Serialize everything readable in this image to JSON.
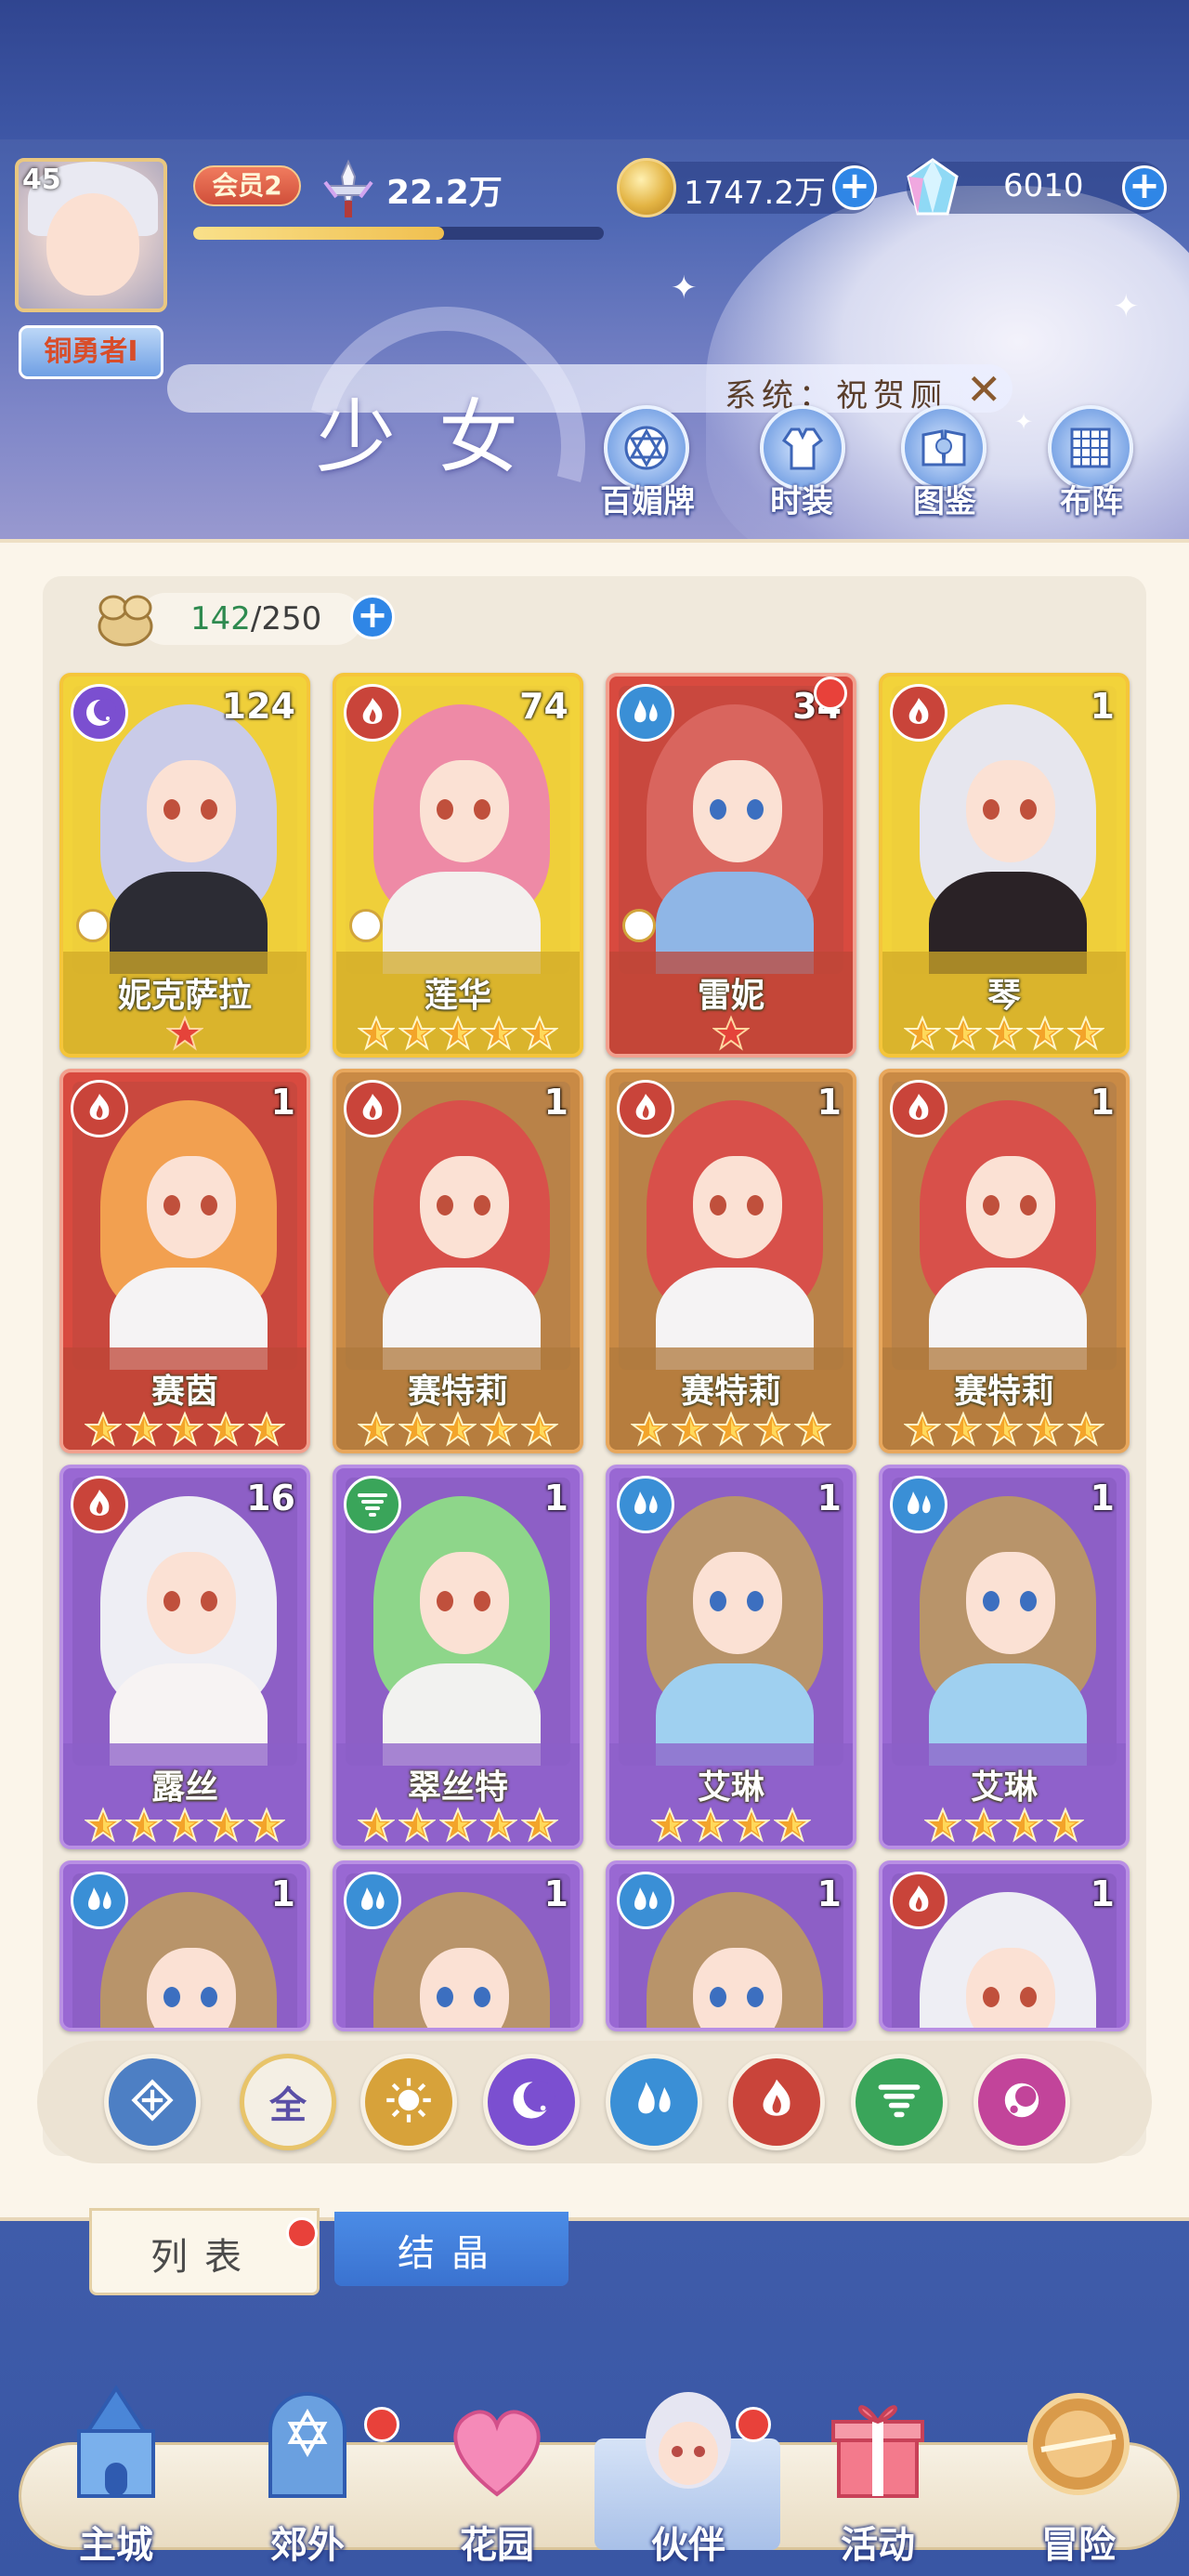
{
  "player": {
    "level": "45",
    "rank": "铜勇者Ⅰ",
    "vip": "会员2",
    "power": "22.2万",
    "exp_fraction": 0.61
  },
  "currency": {
    "gold": "1747.2万",
    "gems": "6010"
  },
  "notice": {
    "text": "系统：祝贺厕"
  },
  "header": {
    "title": "少女"
  },
  "menu": {
    "items": [
      {
        "label": "百媚牌",
        "icon": "card-icon"
      },
      {
        "label": "时装",
        "icon": "outfit-icon"
      },
      {
        "label": "图鉴",
        "icon": "book-icon"
      },
      {
        "label": "布阵",
        "icon": "formation-icon"
      }
    ]
  },
  "capacity": {
    "current": "142",
    "max": "/250"
  },
  "cards": [
    {
      "name": "妮克萨拉",
      "count": "124",
      "stars": 1,
      "element": "moon",
      "frame": "gold"
    },
    {
      "name": "莲华",
      "count": "74",
      "stars": 5,
      "element": "fire",
      "frame": "gold"
    },
    {
      "name": "雷妮",
      "count": "34",
      "stars": 1,
      "element": "water",
      "frame": "red"
    },
    {
      "name": "琴",
      "count": "1",
      "stars": 5,
      "element": "fire",
      "frame": "gold"
    },
    {
      "name": "赛茵",
      "count": "1",
      "stars": 5,
      "element": "fire",
      "frame": "red"
    },
    {
      "name": "赛特莉",
      "count": "1",
      "stars": 5,
      "element": "fire",
      "frame": "orange"
    },
    {
      "name": "赛特莉",
      "count": "1",
      "stars": 5,
      "element": "fire",
      "frame": "orange"
    },
    {
      "name": "赛特莉",
      "count": "1",
      "stars": 5,
      "element": "fire",
      "frame": "orange"
    },
    {
      "name": "露丝",
      "count": "16",
      "stars": 5,
      "element": "fire",
      "frame": "purple"
    },
    {
      "name": "翠丝特",
      "count": "1",
      "stars": 5,
      "element": "wind",
      "frame": "purple"
    },
    {
      "name": "艾琳",
      "count": "1",
      "stars": 4,
      "element": "water",
      "frame": "purple"
    },
    {
      "name": "艾琳",
      "count": "1",
      "stars": 4,
      "element": "water",
      "frame": "purple"
    },
    {
      "name": "",
      "count": "1",
      "stars": 0,
      "element": "water",
      "frame": "purple"
    },
    {
      "name": "",
      "count": "1",
      "stars": 0,
      "element": "water",
      "frame": "purple"
    },
    {
      "name": "",
      "count": "1",
      "stars": 0,
      "element": "water",
      "frame": "purple"
    },
    {
      "name": "",
      "count": "1",
      "stars": 0,
      "element": "fire",
      "frame": "purple"
    }
  ],
  "filters": {
    "all_label": "全",
    "items": [
      "class-icon",
      "all",
      "sun-icon",
      "moon-icon",
      "water-icon",
      "fire-icon",
      "wind-icon",
      "dark-icon"
    ]
  },
  "tabs": {
    "list": "列表",
    "crystal": "结晶"
  },
  "nav": {
    "items": [
      {
        "label": "主城",
        "icon": "castle-icon"
      },
      {
        "label": "郊外",
        "icon": "gate-icon"
      },
      {
        "label": "花园",
        "icon": "heart-icon"
      },
      {
        "label": "伙伴",
        "icon": "partner-icon"
      },
      {
        "label": "活动",
        "icon": "gift-icon"
      },
      {
        "label": "冒险",
        "icon": "compass-icon"
      }
    ]
  },
  "colors": {
    "accent": "#2f86e6",
    "badge_red": "#e8413a",
    "fire": "#c9443a",
    "water": "#3a8fd6",
    "moon": "#7b4fd0",
    "wind": "#3aa55a",
    "sun": "#d7a23a",
    "dark": "#c2449a"
  }
}
